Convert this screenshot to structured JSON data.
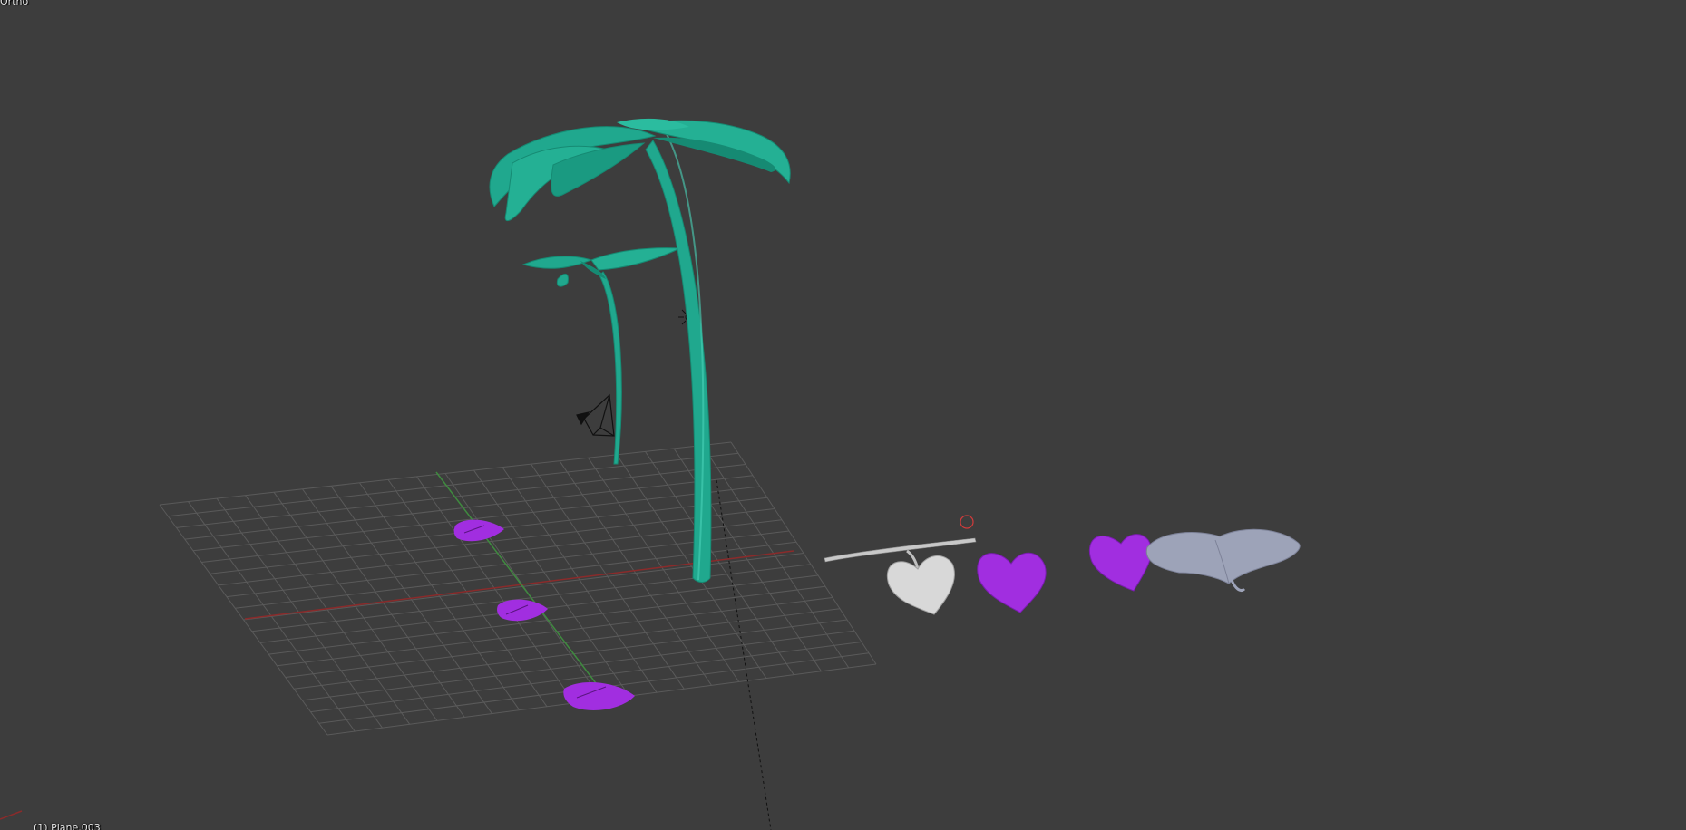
{
  "viewport": {
    "view_label": "r Ortho",
    "object_label": "(1) Plane.003"
  },
  "scene": {
    "background_color": "#3d3d3d",
    "grid_color": "#5a5a5a",
    "x_axis_color": "#8a2b2b",
    "y_axis_color": "#3f8a3f",
    "palm_color": "#20a88e",
    "palm_shade_color": "#168a73",
    "leaf_purple_color": "#a12ee0",
    "leaf_white_color": "#d8d8d8",
    "leaf_grey_color": "#9da3b8",
    "cursor_color": "#d23b3b",
    "icons": [
      "camera-icon",
      "light-icon",
      "3d-cursor-icon",
      "axis-gizmo-icon"
    ]
  }
}
